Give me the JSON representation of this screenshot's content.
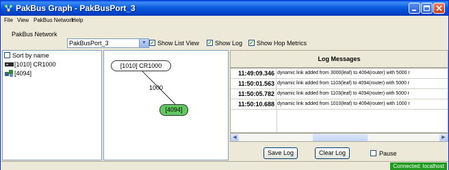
{
  "window": {
    "title": "PakBus Graph - PakBusPort_3"
  },
  "menu": {
    "items": [
      "File",
      "View",
      "PakBus Network",
      "Help"
    ]
  },
  "toolbar": {
    "network_label": "PakBus Network",
    "network_value": "PakBusPort_3",
    "show_list_view": "Show List View",
    "show_log": "Show Log",
    "show_hop_metrics": "Show Hop Metrics",
    "show_list_view_checked": true,
    "show_log_checked": true,
    "show_hop_metrics_checked": true
  },
  "left_panel": {
    "sort_by_name": "Sort by name",
    "sort_checked": false,
    "items": [
      "[1010] CR1000",
      "[4094]"
    ]
  },
  "graph": {
    "nodes": [
      "[1010] CR1000",
      "[4094]"
    ],
    "link_label": "1000"
  },
  "log": {
    "header": "Log Messages",
    "rows": [
      {
        "time": "11:49:09.346",
        "message": "dynamic link added from 3000(leaf) to 4094(router) with 5000 r"
      },
      {
        "time": "11:50:01.563",
        "message": "dynamic link added from 1103(leaf) to 4094(router) with 5000 r"
      },
      {
        "time": "11:50:05.782",
        "message": "dynamic link added from 1103(leaf) to 4094(router) with 5000 r"
      },
      {
        "time": "11:50:10.688",
        "message": "dynamic link added from 1010(leaf) to 4094(router) with 1000 r"
      }
    ],
    "save_label": "Save Log",
    "clear_label": "Clear Log",
    "pause_label": "Pause",
    "pause_checked": false
  },
  "status": {
    "connection": "Connected: localhost"
  },
  "colors": {
    "titlebar": "#0a5fe0",
    "router_node": "#5fc85f",
    "connected": "#1f9a1f"
  }
}
